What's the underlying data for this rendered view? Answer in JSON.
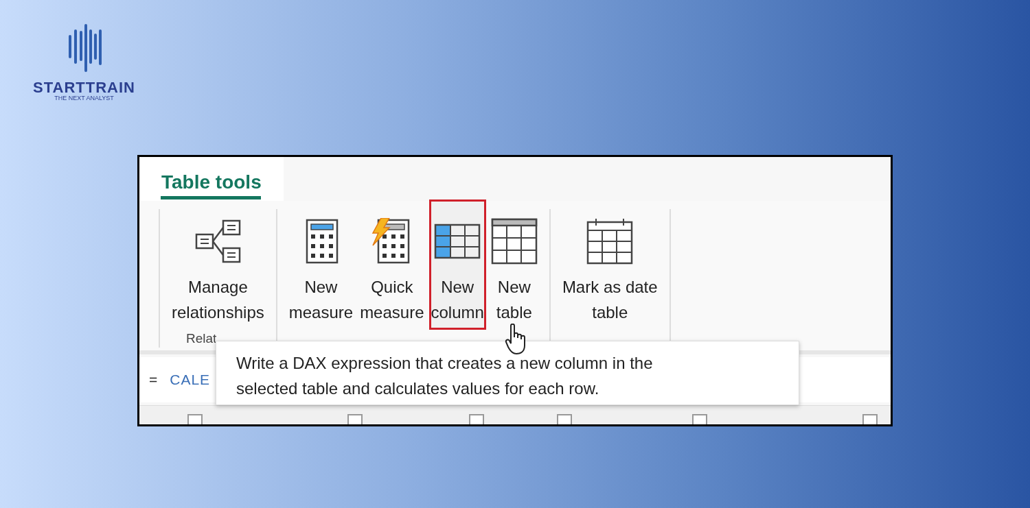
{
  "logo": {
    "name": "STARTTRAIN",
    "tagline": "THE NEXT ANALYST"
  },
  "ribbon": {
    "tabs": [
      {
        "label": "Table tools",
        "selected": true
      }
    ],
    "groups": [
      {
        "label": "Relat",
        "buttons": [
          {
            "lines": [
              "Manage",
              "relationships"
            ],
            "kind": "relationships",
            "highlighted": false
          }
        ]
      },
      {
        "buttons": [
          {
            "lines": [
              "New",
              "measure"
            ],
            "kind": "measure",
            "highlighted": false
          },
          {
            "lines": [
              "Quick",
              "measure"
            ],
            "kind": "quick-measure",
            "highlighted": false
          },
          {
            "lines": [
              "New",
              "column"
            ],
            "kind": "column",
            "highlighted": true
          },
          {
            "lines": [
              "New",
              "table"
            ],
            "kind": "table",
            "highlighted": false
          }
        ]
      },
      {
        "buttons": [
          {
            "lines": [
              "Mark as date",
              "table"
            ],
            "kind": "calendar",
            "highlighted": false
          }
        ]
      }
    ]
  },
  "formula_bar": {
    "equals": "=",
    "expression": "CALE"
  },
  "tooltip": {
    "lines": [
      "Write a DAX expression that creates a new column in the",
      "selected table and calculates values for each row."
    ]
  }
}
